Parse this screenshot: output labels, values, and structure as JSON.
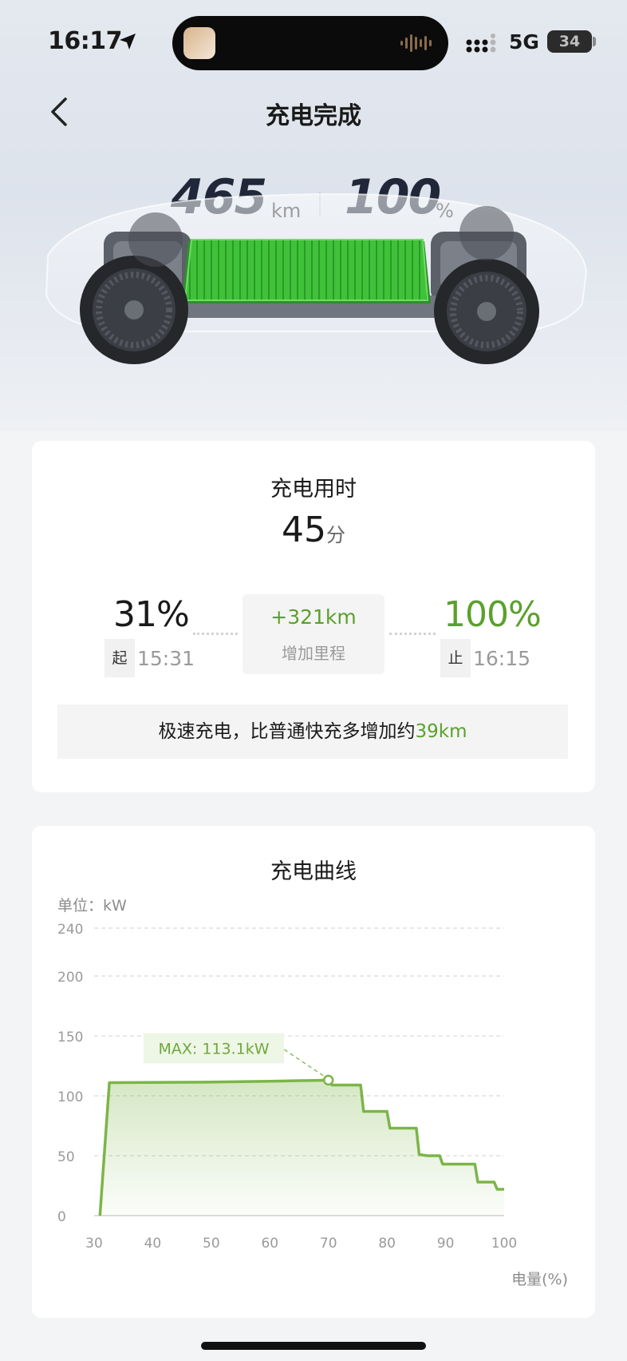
{
  "status_bar": {
    "time": "16:17",
    "network": "5G",
    "battery": "34"
  },
  "nav": {
    "title": "充电完成"
  },
  "summary": {
    "range_value": "465",
    "range_unit": "km",
    "soc_value": "100",
    "soc_unit": "%",
    "battery_color": "#3fc23a"
  },
  "session": {
    "duration_label": "充电用时",
    "duration_value": "45",
    "duration_unit": "分",
    "start_pct": "31%",
    "start_tag": "起",
    "start_time": "15:31",
    "end_pct": "100%",
    "end_tag": "止",
    "end_time": "16:15",
    "added_range": "+321km",
    "added_range_label": "增加里程",
    "note_prefix": "极速充电，比普通快充多增加约",
    "note_highlight": "39km"
  },
  "colors": {
    "accent_green": "#5aa12c",
    "curve_green": "#7cb548"
  },
  "chart_data": {
    "type": "area",
    "title": "充电曲线",
    "unit_label": "单位：kW",
    "xlabel": "电量(%)",
    "ylabel": "",
    "xlim": [
      30,
      100
    ],
    "ylim": [
      0,
      240
    ],
    "x_ticks": [
      "30",
      "40",
      "50",
      "60",
      "70",
      "80",
      "90",
      "100"
    ],
    "y_ticks": [
      "0",
      "50",
      "100",
      "150",
      "200",
      "240"
    ],
    "grid": true,
    "max_label": "MAX: 113.1kW",
    "max_point": {
      "x": 70,
      "y": 113.1
    },
    "series": [
      {
        "values": [
          {
            "x": 31,
            "y": 0
          },
          {
            "x": 32.6,
            "y": 111
          },
          {
            "x": 50,
            "y": 111.5
          },
          {
            "x": 60,
            "y": 112.2
          },
          {
            "x": 70,
            "y": 113.1
          },
          {
            "x": 70.6,
            "y": 109
          },
          {
            "x": 75.5,
            "y": 109
          },
          {
            "x": 76,
            "y": 87
          },
          {
            "x": 80,
            "y": 87
          },
          {
            "x": 80.5,
            "y": 73
          },
          {
            "x": 85,
            "y": 73
          },
          {
            "x": 85.5,
            "y": 51
          },
          {
            "x": 87,
            "y": 50
          },
          {
            "x": 89,
            "y": 50
          },
          {
            "x": 89.5,
            "y": 43
          },
          {
            "x": 95,
            "y": 43
          },
          {
            "x": 95.5,
            "y": 28
          },
          {
            "x": 98.3,
            "y": 28
          },
          {
            "x": 98.8,
            "y": 22
          },
          {
            "x": 100,
            "y": 22
          }
        ]
      }
    ]
  }
}
